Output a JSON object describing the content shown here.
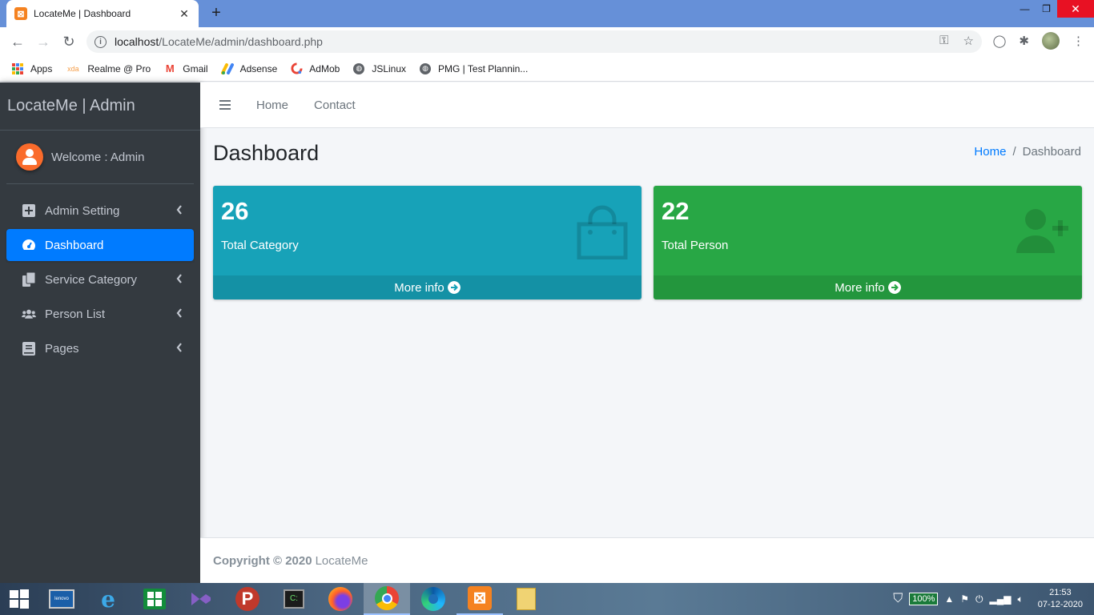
{
  "browser": {
    "tab_title": "LocateMe | Dashboard",
    "tab_favicon": "xampp-icon",
    "url_host": "localhost",
    "url_path": "/LocateMe/admin/dashboard.php",
    "bookmarks": [
      {
        "label": "Apps",
        "icon": "apps-grid-icon"
      },
      {
        "label": "Realme @ Pro",
        "icon": "xda-icon"
      },
      {
        "label": "Gmail",
        "icon": "gmail-icon"
      },
      {
        "label": "Adsense",
        "icon": "adsense-icon"
      },
      {
        "label": "AdMob",
        "icon": "admob-icon"
      },
      {
        "label": "JSLinux",
        "icon": "globe-icon"
      },
      {
        "label": "PMG | Test Plannin...",
        "icon": "globe-icon"
      }
    ]
  },
  "sidebar": {
    "brand": "LocateMe | Admin",
    "welcome": "Welcome : Admin",
    "items": [
      {
        "label": "Admin Setting",
        "icon": "plus-square-icon",
        "has_caret": true
      },
      {
        "label": "Dashboard",
        "icon": "tachometer-icon",
        "active": true
      },
      {
        "label": "Service Category",
        "icon": "copy-icon",
        "has_caret": true
      },
      {
        "label": "Person List",
        "icon": "users-icon",
        "has_caret": true
      },
      {
        "label": "Pages",
        "icon": "book-icon",
        "has_caret": true
      }
    ]
  },
  "header": {
    "links": [
      "Home",
      "Contact"
    ]
  },
  "content": {
    "title": "Dashboard",
    "breadcrumb": [
      "Home",
      "Dashboard"
    ],
    "boxes": [
      {
        "number": "26",
        "label": "Total Category",
        "footer": "More info",
        "icon": "shopping-bag-icon",
        "color": "#17a2b8"
      },
      {
        "number": "22",
        "label": "Total Person",
        "footer": "More info",
        "icon": "user-plus-icon",
        "color": "#28a745"
      }
    ]
  },
  "footer": {
    "copyright": "Copyright © 2020",
    "brand": "LocateMe"
  },
  "taskbar": {
    "battery": "100%",
    "time": "21:53",
    "date": "07-12-2020",
    "apps": [
      "lenovo-icon",
      "internet-explorer-icon",
      "store-icon",
      "visual-studio-icon",
      "psiphon-icon",
      "terminal-icon",
      "firefox-icon",
      "chrome-icon",
      "edge-icon",
      "xampp-icon",
      "file-explorer-icon"
    ]
  },
  "colors": {
    "accent": "#007bff",
    "sidebar_bg": "#343a40",
    "info": "#17a2b8",
    "success": "#28a745"
  }
}
